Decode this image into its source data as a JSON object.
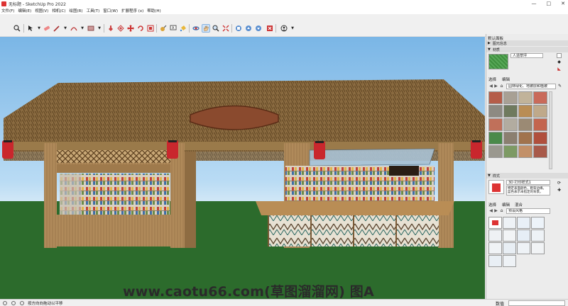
{
  "window": {
    "title": "无标题 - SketchUp Pro 2022",
    "minimize": "—",
    "maximize": "□",
    "close": "✕"
  },
  "menu": [
    "文件(F)",
    "编辑(E)",
    "视图(V)",
    "相机(C)",
    "绘图(R)",
    "工具(T)",
    "窗口(W)",
    "扩展程序 (x)",
    "帮助(H)"
  ],
  "watermark": "www.caotu66.com(草图溜溜网) 图A",
  "status": {
    "hint": "按方向向拖动以平移",
    "measure_label": "数值",
    "measure_value": ""
  },
  "tray": {
    "title": "默认面板",
    "sections": {
      "entity_info": "图元信息",
      "materials": "材质",
      "styles": "样式"
    },
    "materials": {
      "current_name": "人造草坪",
      "tab_select": "选择",
      "tab_edit": "编辑",
      "library": "园林绿化、地被层和植被"
    },
    "styles": {
      "current_name": "3D 打印样式1",
      "description": "特定表面颜色，粗背边缘。蓝色表示未指定的背景。",
      "tab_select": "选择",
      "tab_edit": "编辑",
      "tab_mix": "混合",
      "library": "预设风格"
    }
  },
  "colors": {
    "sky_top": "#7ab6e6",
    "ground": "#2c6b2c",
    "thatch": "#8a6a3e",
    "wood": "#b08a5a"
  }
}
